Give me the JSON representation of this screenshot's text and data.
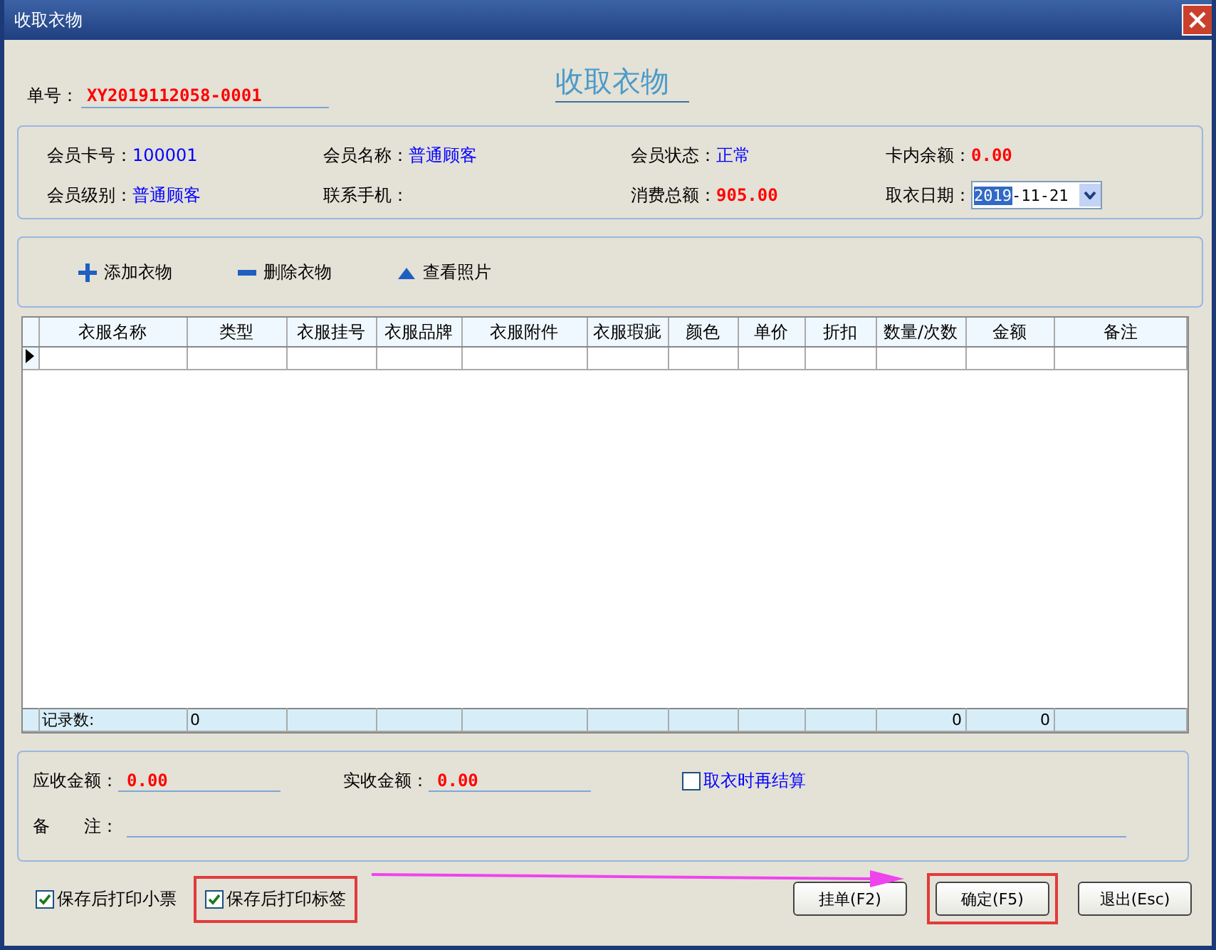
{
  "window": {
    "title": "收取衣物"
  },
  "heading": "收取衣物",
  "order": {
    "label": "单号：",
    "value": "XY2019112058-0001"
  },
  "member": [
    {
      "label": "会员卡号：",
      "value": "100001",
      "kind": "plain"
    },
    {
      "label": "会员名称：",
      "value": "普通顾客",
      "kind": "plain"
    },
    {
      "label": "会员状态：",
      "value": "正常",
      "kind": "plain"
    },
    {
      "label": "卡内余额：",
      "value": "0.00",
      "kind": "money"
    },
    {
      "label": "会员级别：",
      "value": "普通顾客",
      "kind": "plain"
    },
    {
      "label": "联系手机：",
      "kind": "plain"
    },
    {
      "label": "消费总额：",
      "value": "905.00",
      "kind": "money"
    },
    {
      "label": "取衣日期：",
      "value_selected": "2019",
      "value_rest": "-11-21",
      "kind": "date"
    }
  ],
  "toolbar": [
    {
      "label": "添加衣物",
      "kind": "add"
    },
    {
      "label": "删除衣物",
      "kind": "remove"
    },
    {
      "label": "查看照片",
      "kind": "photo"
    }
  ],
  "table": {
    "columns": [
      "衣服名称",
      "类型",
      "衣服挂号",
      "衣服品牌",
      "衣服附件",
      "衣服瑕疵",
      "颜色",
      "单价",
      "折扣",
      "数量/次数",
      "金额",
      "备注"
    ],
    "rows": [
      {
        "current": true
      }
    ],
    "footer": {
      "record_count_label": "记录数:",
      "record_count": "0",
      "quantity_total": "0",
      "amount_total": "0"
    }
  },
  "totals": [
    {
      "label": "应收金额：",
      "value": "0.00"
    },
    {
      "label": "实收金额：",
      "value": "0.00"
    }
  ],
  "settle_later": {
    "label": "取衣时再结算",
    "checked": false
  },
  "remark": {
    "label": "备　　注："
  },
  "print_options": [
    {
      "label": "保存后打印小票",
      "checked": true,
      "highlighted": false
    },
    {
      "label": "保存后打印标签",
      "checked": true,
      "highlighted": true
    }
  ],
  "buttons": [
    {
      "label": "挂单(F2)",
      "highlighted": false
    },
    {
      "label": "确定(F5)",
      "highlighted": true
    },
    {
      "label": "退出(Esc)",
      "highlighted": false
    }
  ],
  "annotation_arrow": true
}
